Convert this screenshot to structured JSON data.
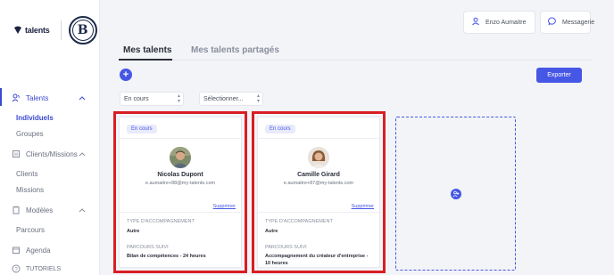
{
  "sidebar": {
    "brand_text": "talents",
    "brand_mark": "my",
    "partner_logo": "B",
    "nav": {
      "talents": "Talents",
      "individuels": "Individuels",
      "groupes": "Groupes",
      "clients_missions": "Clients/Missions",
      "clients": "Clients",
      "missions": "Missions",
      "modeles": "Modèles",
      "parcours": "Parcours",
      "agenda": "Agenda",
      "tutoriels": "TUTORIELS"
    }
  },
  "header": {
    "user_name": "Enzo Aumaitre",
    "messages_label": "Messagerie"
  },
  "tabs": [
    {
      "label": "Mes talents",
      "active": true
    },
    {
      "label": "Mes talents partagés",
      "active": false
    }
  ],
  "toolbar": {
    "add_label": "+",
    "export_label": "Exporter",
    "status_select": "En cours",
    "other_select": "Sélectionner..."
  },
  "cards": [
    {
      "badge": "En cours",
      "name": "Nicolas Dupont",
      "email": "e.aumaitre+88@my-talents.com",
      "delete_label": "Supprimer",
      "type_label": "TYPE D'ACCOMPAGNEMENT",
      "type_value": "Autre",
      "parcours_label": "PARCOURS SUIVI",
      "parcours_value": "Bilan de compétences - 24 heures"
    },
    {
      "badge": "En cours",
      "name": "Camille Girard",
      "email": "e.aumaitre+87@my-talents.com",
      "delete_label": "Supprimer",
      "type_label": "TYPE D'ACCOMPAGNEMENT",
      "type_value": "Autre",
      "parcours_label": "PARCOURS SUIVI",
      "parcours_value": "Accompagnement du créateur d'entreprise - 10 heures"
    }
  ],
  "colors": {
    "accent": "#4657e6",
    "highlight_border": "#d81e23",
    "background": "#f3f4f7"
  }
}
